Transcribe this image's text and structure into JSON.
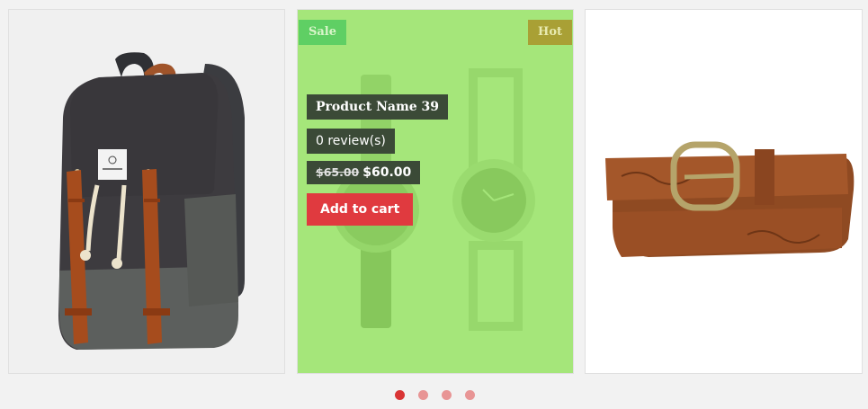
{
  "products": [
    {
      "image": "backpack",
      "image_icon": "backpack-icon"
    },
    {
      "image": "watches",
      "image_icon": "watch-icon",
      "badges": {
        "sale": "Sale",
        "hot": "Hot"
      },
      "name": "Product Name 39",
      "reviews": "0 review(s)",
      "old_price": "$65.00",
      "price": "$60.00",
      "cart_label": "Add to cart"
    },
    {
      "image": "belt",
      "image_icon": "belt-icon"
    }
  ],
  "pagination": {
    "count": 4,
    "active": 0
  },
  "colors": {
    "overlay": "#96e364",
    "sale_badge": "#5fcf64",
    "hot_badge": "#a9a035",
    "info_box": "#3b4a37",
    "cart_button": "#e03a3f",
    "dot_active": "#d93535",
    "dot_inactive": "#e89595"
  }
}
